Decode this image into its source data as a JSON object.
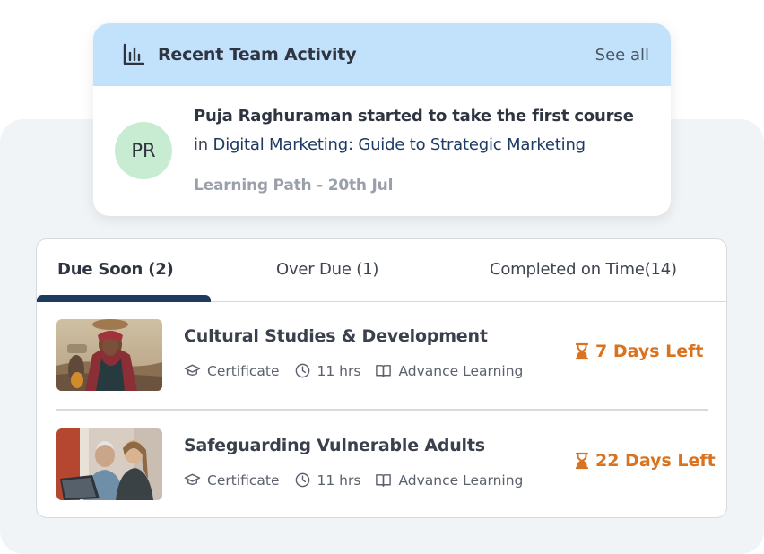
{
  "activity": {
    "title": "Recent Team Activity",
    "see_all": "See all",
    "avatar_initials": "PR",
    "line1": "Puja Raghuraman started to take the first course",
    "line2_prefix": "in ",
    "line2_link": "Digital Marketing: Guide to Strategic Marketing",
    "meta": "Learning Path - 20th Jul",
    "icon": "bar-chart-icon"
  },
  "tabs": [
    {
      "label": "Due Soon (2)",
      "active": true
    },
    {
      "label": "Over Due (1)",
      "active": false
    },
    {
      "label": "Completed on Time(14)",
      "active": false
    }
  ],
  "courses": [
    {
      "title": "Cultural Studies & Development",
      "type": "Certificate",
      "duration": "11 hrs",
      "level": "Advance Learning",
      "due": "7 Days Left"
    },
    {
      "title": "Safeguarding Vulnerable Adults",
      "type": "Certificate",
      "duration": "11 hrs",
      "level": "Advance Learning",
      "due": "22 Days Left"
    }
  ],
  "colors": {
    "header_bg": "#c2e1fb",
    "tab_indicator": "#1f3a5f",
    "due_accent": "#d9731f",
    "avatar_bg": "#c8ecd1"
  }
}
